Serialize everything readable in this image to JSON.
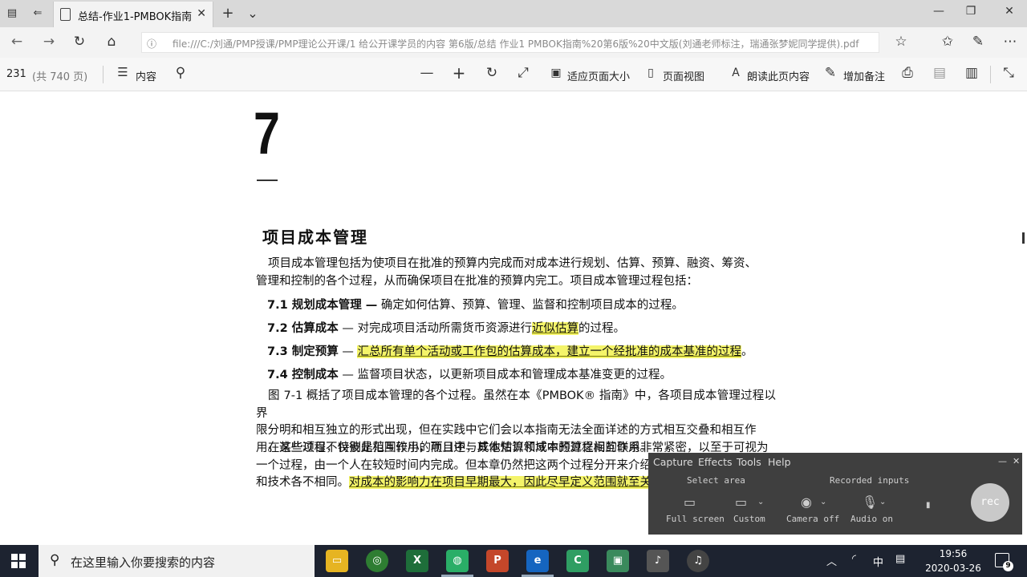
{
  "browser": {
    "tab_title": "总结-作业1-PMBOK指南",
    "tab_close": "✕",
    "new_tab": "+",
    "tab_list": "⌄",
    "url_prefix": "ⓘ",
    "url": "file:///C:/刘通/PMP授课/PMP理论公开课/1 给公开课学员的内容 第6版/总结 作业1 PMBOK指南%20第6版%20中文版(刘通老师标注，瑞通张梦妮同学提供).pdf",
    "win_minimize": "—",
    "win_restore": "❐",
    "win_close": "✕"
  },
  "pdf_toolbar": {
    "page_current": "231",
    "page_total": "(共 740 页)",
    "contents": "内容",
    "fit_page": "适应页面大小",
    "page_view": "页面视图",
    "read_aloud": "朗读此页内容",
    "add_note": "增加备注"
  },
  "document": {
    "chapter_number": "7",
    "chapter_title": "项目成本管理",
    "intro_line1": "项目成本管理包括为使项目在批准的预算内完成而对成本进行规划、估算、预算、融资、筹资、",
    "intro_line2": "管理和控制的各个过程，从而确保项目在批准的预算内完工。项目成本管理过程包括：",
    "item1_bold": "7.1 规划成本管理 —",
    "item1_text": " 确定如何估算、预算、管理、监督和控制项目成本的过程。",
    "item2_bold": "7.2 估算成本",
    "item2_text": " — 对完成项目活动所需货币资源进行",
    "item2_hl": "近似估算",
    "item2_end": "的过程。",
    "item3_bold": "7.3 制定预算",
    "item3_dash": " — ",
    "item3_hl": "汇总所有单个活动或工作包的估算成本，建立一个经批准的成本基准的过程",
    "item3_end": "。",
    "item4_bold": "7.4 控制成本",
    "item4_text": " — 监督项目状态，以更新项目成本和管理成本基准变更的过程。",
    "para2_line1": "图 7-1 概括了项目成本管理的各个过程。虽然在本《PMBOK® 指南》中，各项目成本管理过程以界",
    "para2_line2": "限分明和相互独立的形式出现，但在实践中它们会以本指南无法全面详述的方式相互交叠和相互作",
    "para2_line3": "用。这些过程不仅彼此相互作用，而且还与其他知识领域中的过程相互作用。",
    "para3_line1": "在某些项目，特别是范围较小的项目中，成本估算和成本预算之间的联系非常紧密，以至于可视为",
    "para3_line2": "一个过程，由一个人在较短时间内完成。但本章仍然把这两个过程分开来介绍",
    "para3_line3a": "和技术各不相同。",
    "para3_line3_hl": "对成本的影响力在项目早期最大，因此尽早定义范围就至关"
  },
  "capture_widget": {
    "menu": [
      "Capture",
      "Effects",
      "Tools",
      "Help"
    ],
    "select_area": "Select area",
    "recorded_inputs": "Recorded inputs",
    "full_screen": "Full screen",
    "custom": "Custom",
    "camera": "Camera off",
    "audio": "Audio on",
    "rec": "rec",
    "minimize": "—",
    "close": "✕"
  },
  "taskbar": {
    "search_placeholder": "在这里输入你要搜索的内容",
    "ime": "中",
    "time": "19:56",
    "date": "2020-03-26",
    "notifications": "9"
  },
  "colors": {
    "highlight": "#f4f46a",
    "taskbar": "#1d2330",
    "capture_bg": "#3f3f3f"
  }
}
